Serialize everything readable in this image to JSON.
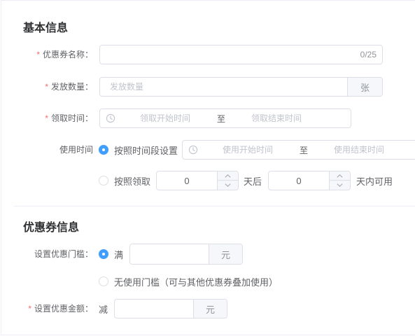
{
  "theme": {
    "primary": "#409eff",
    "required": "#f56c6c",
    "text": "#606266",
    "title": "#303133",
    "placeholder": "#c0c4cc",
    "border": "#dcdfe6"
  },
  "icons": {
    "time": "clock-icon",
    "increase": "chevron-up-icon",
    "decrease": "chevron-down-icon"
  },
  "basic": {
    "title": "基本信息",
    "name": {
      "required_mark": "*",
      "label": "优惠券名称：",
      "counter": "0/25"
    },
    "quantity": {
      "required_mark": "*",
      "label": "发放数量：",
      "placeholder": "发放数量",
      "unit": "张"
    },
    "receive_time": {
      "required_mark": "*",
      "label": "领取时间：",
      "start_placeholder": "领取开始时间",
      "separator": "至",
      "end_placeholder": "领取结束时间"
    },
    "use_time": {
      "label": "使用时间",
      "by_period": {
        "label": "按照时间段设置",
        "checked": true,
        "start_placeholder": "使用开始时间",
        "separator": "至",
        "end_placeholder": "使用结束时间"
      },
      "by_receive": {
        "label": "按照领取",
        "checked": false,
        "after_days": "0",
        "after_suffix": "天后",
        "valid_days": "0",
        "valid_suffix": "天内可用"
      }
    }
  },
  "coupon": {
    "title": "优惠券信息",
    "threshold": {
      "label": "设置优惠门槛：",
      "with_threshold": {
        "label": "满",
        "checked": true,
        "unit": "元"
      },
      "no_threshold": {
        "label": "无使用门槛（可与其他优惠券叠加使用）",
        "checked": false
      }
    },
    "discount": {
      "required_mark": "*",
      "label": "设置优惠金额：",
      "prefix": "减",
      "unit": "元"
    }
  }
}
